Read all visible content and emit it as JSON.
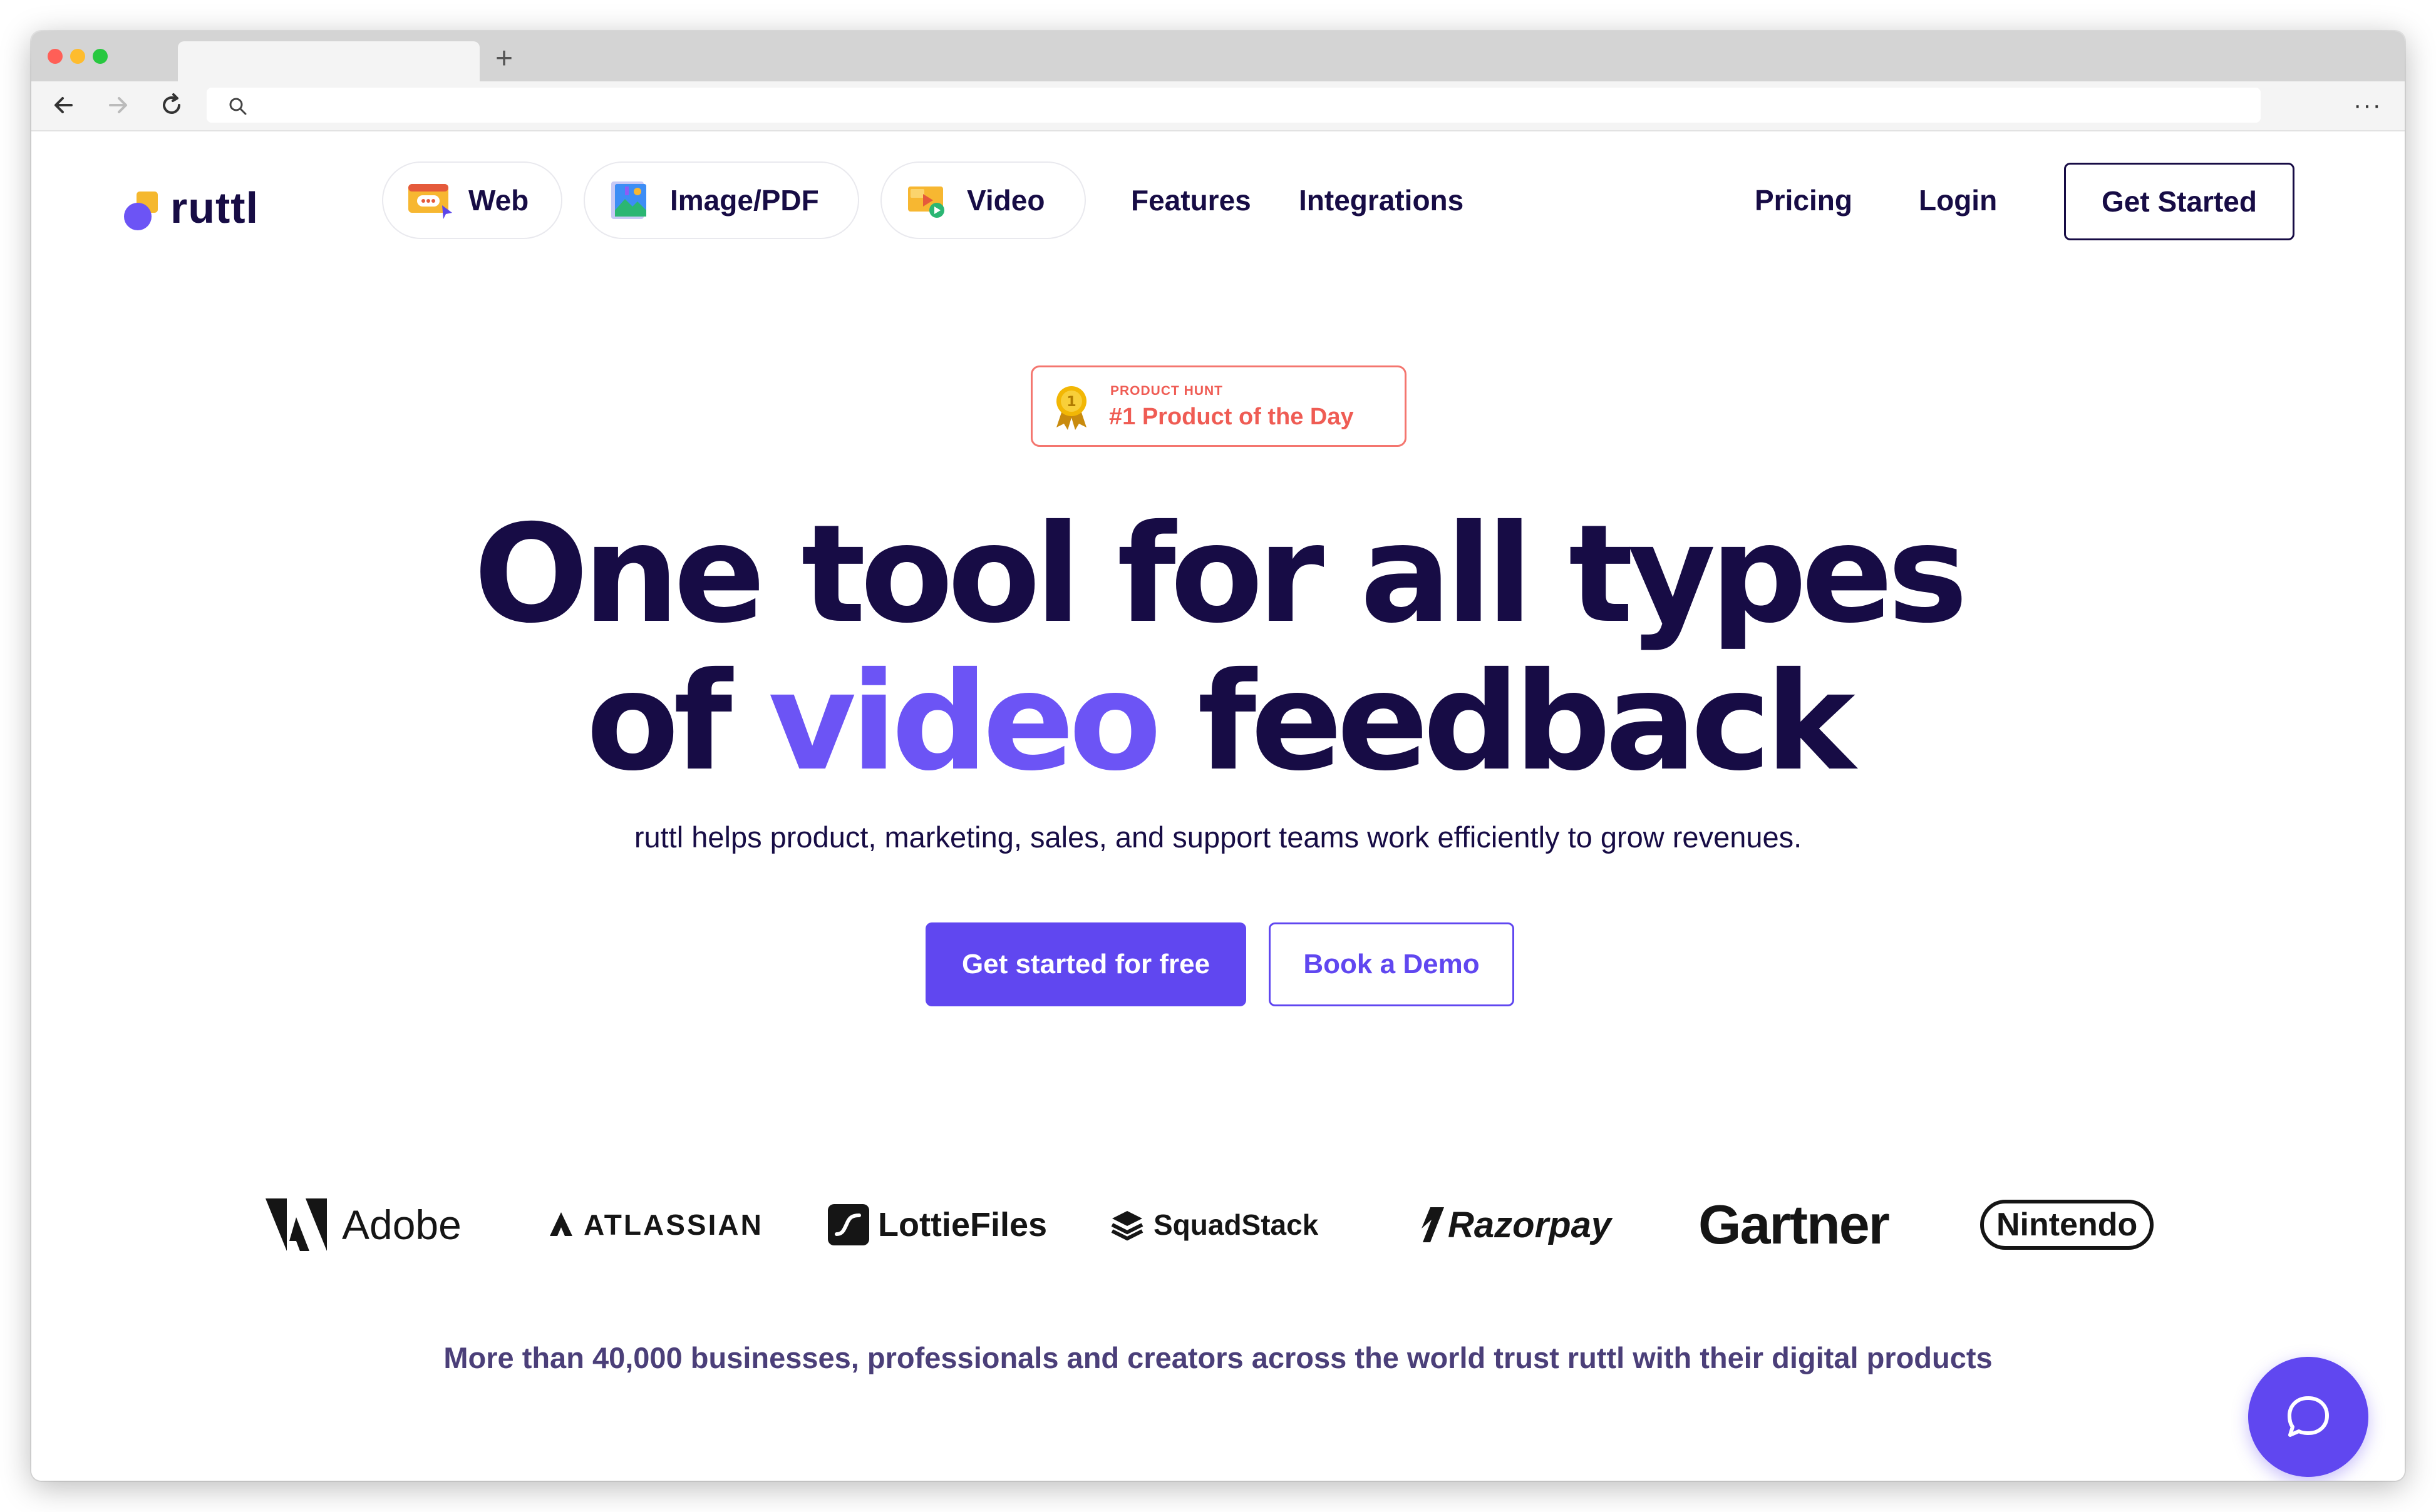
{
  "browser": {
    "tab_title": "",
    "new_tab": "+",
    "address_placeholder": "",
    "menu": "···"
  },
  "header": {
    "logo_text": "ruttl",
    "products": [
      "Web",
      "Image/PDF",
      "Video"
    ],
    "nav_links": [
      "Features",
      "Integrations"
    ],
    "right_links": [
      "Pricing",
      "Login"
    ],
    "cta": "Get Started"
  },
  "badge": {
    "kicker": "PRODUCT HUNT",
    "title": "#1 Product of the Day",
    "medal_number": "1"
  },
  "hero": {
    "line1": "One tool for all types",
    "line2_before": "of ",
    "line2_accent": "video",
    "line2_after": " feedback",
    "subtitle": "ruttl helps product, marketing, sales, and support teams work efficiently to grow revenues.",
    "primary_button": "Get started for free",
    "secondary_button": "Book a Demo"
  },
  "logos": [
    "Adobe",
    "ATLASSIAN",
    "LottieFiles",
    "SquadStack",
    "Razorpay",
    "Gartner",
    "Nintendo"
  ],
  "trust_text": "More than 40,000 businesses, professionals and creators across the world trust ruttl with their digital products",
  "colors": {
    "brand_navy": "#170c45",
    "brand_purple": "#6047f0",
    "accent_purple": "#6c54f5",
    "badge_red": "#ef5c54"
  },
  "icons": {
    "chat": "chat-bubble-icon",
    "web": "web-comment-icon",
    "image": "image-pdf-icon",
    "video": "video-play-icon"
  }
}
